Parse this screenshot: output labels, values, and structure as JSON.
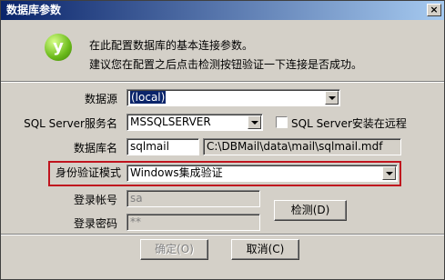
{
  "window": {
    "title": "数据库参数",
    "close_glyph": "×"
  },
  "header": {
    "logo_glyph": "y",
    "line1": "在此配置数据库的基本连接参数。",
    "line2": "建议您在配置之后点击检测按钮验证一下连接是否成功。"
  },
  "form": {
    "datasource": {
      "label": "数据源",
      "value": "(local)"
    },
    "server_name": {
      "label": "SQL Server服务名",
      "value": "MSSQLSERVER"
    },
    "remote": {
      "label": "SQL Server安装在远程",
      "checked": false
    },
    "db_name": {
      "label": "数据库名",
      "value": "sqlmail",
      "path": "C:\\DBMail\\data\\mail\\sqlmail.mdf"
    },
    "auth_mode": {
      "label": "身份验证模式",
      "value": "Windows集成验证"
    },
    "login_account": {
      "label": "登录帐号",
      "value": "sa"
    },
    "login_password": {
      "label": "登录密码",
      "value": "**"
    }
  },
  "buttons": {
    "test": "检测(D)",
    "ok": "确定(O)",
    "cancel": "取消(C)"
  }
}
